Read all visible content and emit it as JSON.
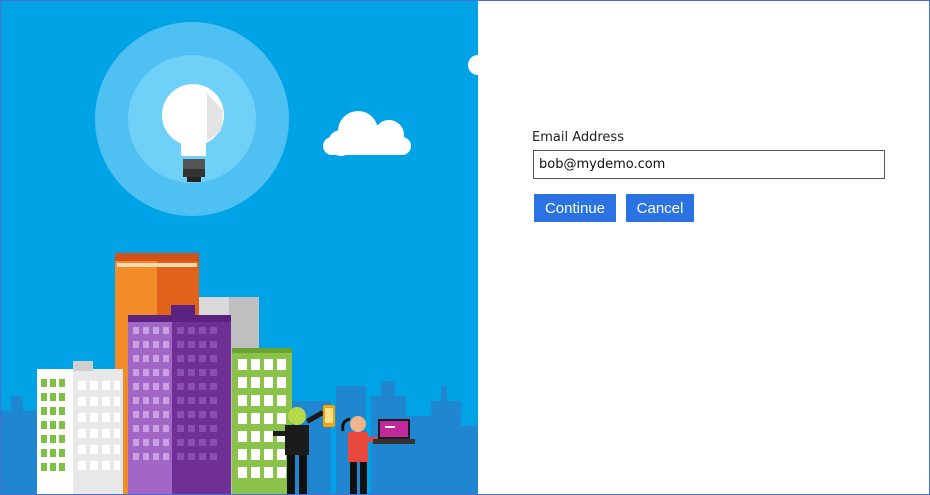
{
  "login": {
    "email_label": "Email Address",
    "email_value": "bob@mydemo.com",
    "continue_label": "Continue",
    "cancel_label": "Cancel"
  },
  "colors": {
    "sky": "#00a3e6",
    "button": "#2b73e3"
  },
  "icons": [
    "lightbulb-icon",
    "cloud-icon"
  ]
}
